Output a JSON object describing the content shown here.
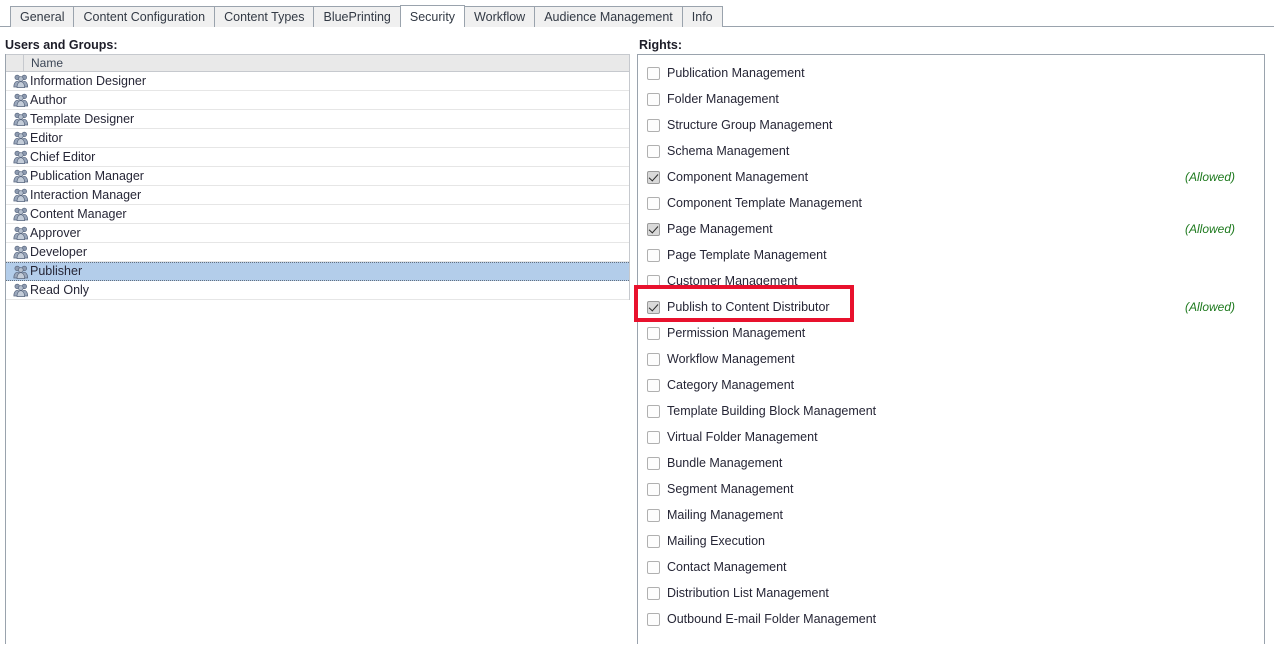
{
  "tabs": [
    {
      "label": "General",
      "active": false
    },
    {
      "label": "Content Configuration",
      "active": false
    },
    {
      "label": "Content Types",
      "active": false
    },
    {
      "label": "BluePrinting",
      "active": false
    },
    {
      "label": "Security",
      "active": true
    },
    {
      "label": "Workflow",
      "active": false
    },
    {
      "label": "Audience Management",
      "active": false
    },
    {
      "label": "Info",
      "active": false
    }
  ],
  "left_panel": {
    "caption": "Users and Groups:",
    "columns": [
      "",
      "Name"
    ],
    "rows": [
      {
        "name": "Information Designer",
        "icon": "group-icon",
        "selected": false
      },
      {
        "name": "Author",
        "icon": "group-icon",
        "selected": false
      },
      {
        "name": "Template Designer",
        "icon": "group-icon",
        "selected": false
      },
      {
        "name": "Editor",
        "icon": "group-icon",
        "selected": false
      },
      {
        "name": "Chief Editor",
        "icon": "group-icon",
        "selected": false
      },
      {
        "name": "Publication Manager",
        "icon": "group-icon",
        "selected": false
      },
      {
        "name": "Interaction Manager",
        "icon": "group-icon",
        "selected": false
      },
      {
        "name": "Content Manager",
        "icon": "group-icon",
        "selected": false
      },
      {
        "name": "Approver",
        "icon": "group-icon",
        "selected": false
      },
      {
        "name": "Developer",
        "icon": "group-icon",
        "selected": false
      },
      {
        "name": "Publisher",
        "icon": "group-icon",
        "selected": true
      },
      {
        "name": "Read Only",
        "icon": "group-icon",
        "selected": false
      }
    ]
  },
  "right_panel": {
    "caption": "Rights:",
    "allowed_label": "(Allowed)",
    "rights": [
      {
        "label": "Publication Management",
        "checked": false,
        "status": ""
      },
      {
        "label": "Folder Management",
        "checked": false,
        "status": ""
      },
      {
        "label": "Structure Group Management",
        "checked": false,
        "status": ""
      },
      {
        "label": "Schema Management",
        "checked": false,
        "status": ""
      },
      {
        "label": "Component Management",
        "checked": true,
        "status": "(Allowed)"
      },
      {
        "label": "Component Template Management",
        "checked": false,
        "status": ""
      },
      {
        "label": "Page Management",
        "checked": true,
        "status": "(Allowed)"
      },
      {
        "label": "Page Template Management",
        "checked": false,
        "status": ""
      },
      {
        "label": "Customer Management",
        "checked": false,
        "status": ""
      },
      {
        "label": "Publish to Content Distributor",
        "checked": true,
        "status": "(Allowed)"
      },
      {
        "label": "Permission Management",
        "checked": false,
        "status": ""
      },
      {
        "label": "Workflow Management",
        "checked": false,
        "status": ""
      },
      {
        "label": "Category Management",
        "checked": false,
        "status": ""
      },
      {
        "label": "Template Building Block Management",
        "checked": false,
        "status": ""
      },
      {
        "label": "Virtual Folder Management",
        "checked": false,
        "status": ""
      },
      {
        "label": "Bundle Management",
        "checked": false,
        "status": ""
      },
      {
        "label": "Segment Management",
        "checked": false,
        "status": ""
      },
      {
        "label": "Mailing Management",
        "checked": false,
        "status": ""
      },
      {
        "label": "Mailing Execution",
        "checked": false,
        "status": ""
      },
      {
        "label": "Contact Management",
        "checked": false,
        "status": ""
      },
      {
        "label": "Distribution List Management",
        "checked": false,
        "status": ""
      },
      {
        "label": "Outbound E-mail Folder Management",
        "checked": false,
        "status": ""
      }
    ]
  },
  "annotation": {
    "highlight_target": "Publish to Content Distributor",
    "color": "#e8112d"
  },
  "colors": {
    "selection": "#b3cdea",
    "allowed_text": "#1f7a1f",
    "tab_inactive_bg": "#f0f0f0",
    "border": "#9aa3ad"
  }
}
